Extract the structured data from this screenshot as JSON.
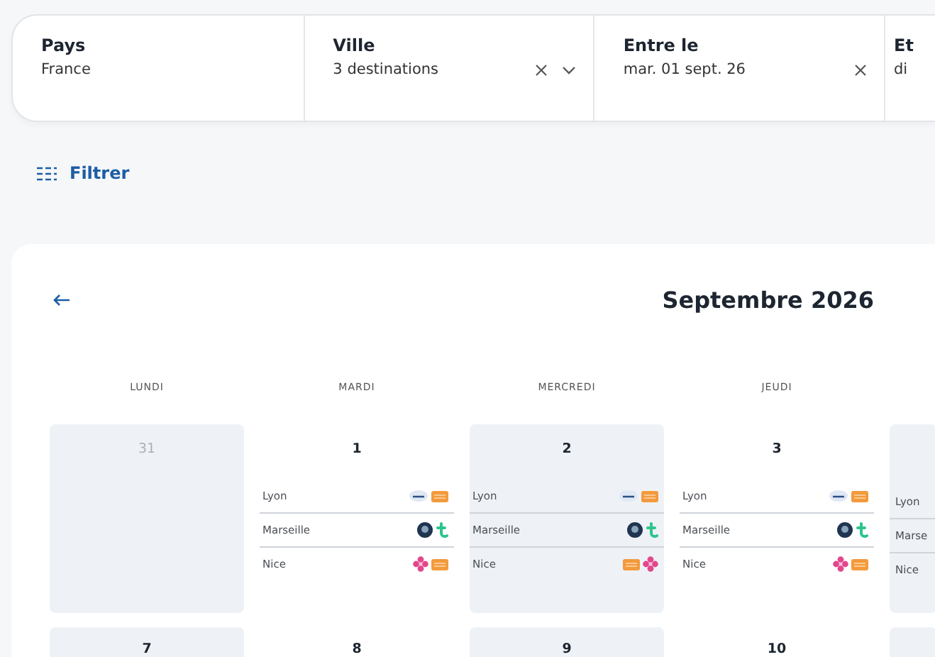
{
  "filters": [
    {
      "label": "Pays",
      "value": "France",
      "clearable": false,
      "dropdown": false
    },
    {
      "label": "Ville",
      "value": "3 destinations",
      "clearable": true,
      "dropdown": true
    },
    {
      "label": "Entre le",
      "value": "mar. 01 sept. 26",
      "clearable": true,
      "dropdown": false
    },
    {
      "label": "Et",
      "value": "di",
      "clearable": false,
      "dropdown": false
    }
  ],
  "filter_button": {
    "label": "Filtrer"
  },
  "calendar": {
    "title": "Septembre 2026",
    "weekdays": [
      "LUNDI",
      "MARDI",
      "MERCREDI",
      "JEUDI"
    ],
    "weeks": [
      [
        {
          "day": "31",
          "outside": true,
          "shaded": true
        },
        {
          "day": "1",
          "outside": false,
          "shaded": false,
          "entries": [
            {
              "city": "Lyon",
              "logos": [
                {
                  "kind": "oval"
                },
                {
                  "kind": "tag"
                }
              ]
            },
            {
              "city": "Marseille",
              "logos": [
                {
                  "kind": "globe"
                },
                {
                  "kind": "hook"
                }
              ]
            },
            {
              "city": "Nice",
              "logos": [
                {
                  "kind": "flower"
                },
                {
                  "kind": "tag"
                }
              ]
            }
          ]
        },
        {
          "day": "2",
          "outside": false,
          "shaded": true,
          "entries": [
            {
              "city": "Lyon",
              "logos": [
                {
                  "kind": "oval"
                },
                {
                  "kind": "tag"
                }
              ]
            },
            {
              "city": "Marseille",
              "logos": [
                {
                  "kind": "globe"
                },
                {
                  "kind": "hook"
                }
              ]
            },
            {
              "city": "Nice",
              "logos": [
                {
                  "kind": "tag"
                },
                {
                  "kind": "flower"
                }
              ]
            }
          ]
        },
        {
          "day": "3",
          "outside": false,
          "shaded": false,
          "entries": [
            {
              "city": "Lyon",
              "logos": [
                {
                  "kind": "oval"
                },
                {
                  "kind": "tag"
                }
              ]
            },
            {
              "city": "Marseille",
              "logos": [
                {
                  "kind": "globe"
                },
                {
                  "kind": "hook"
                }
              ]
            },
            {
              "city": "Nice",
              "logos": [
                {
                  "kind": "flower"
                },
                {
                  "kind": "tag"
                }
              ]
            }
          ]
        },
        {
          "shaded": true,
          "entries": [
            {
              "city": "Lyon"
            },
            {
              "city": "Marse"
            },
            {
              "city": "Nice"
            }
          ]
        }
      ],
      [
        {
          "day": "7",
          "outside": false,
          "shaded": true
        },
        {
          "day": "8",
          "outside": false,
          "shaded": false
        },
        {
          "day": "9",
          "outside": false,
          "shaded": true
        },
        {
          "day": "10",
          "outside": false,
          "shaded": false
        },
        {
          "shaded": true
        }
      ]
    ]
  }
}
